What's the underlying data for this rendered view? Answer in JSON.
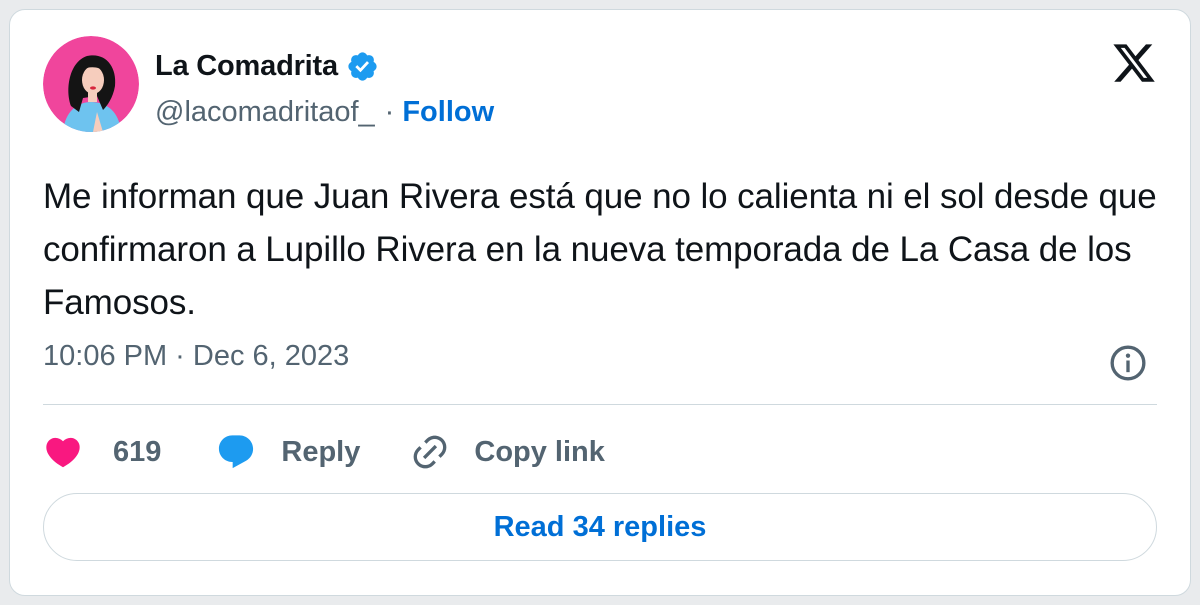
{
  "author": {
    "display_name": "La Comadrita",
    "handle": "@lacomadritaof_",
    "separator": "·",
    "follow_label": "Follow",
    "verified": true
  },
  "tweet": {
    "text": "Me informan que Juan Rivera está que no lo calienta ni el sol desde que confirmaron a Lupillo Rivera en la nueva temporada de La Casa de los Famosos.",
    "timestamp": "10:06 PM · Dec 6, 2023"
  },
  "actions": {
    "like_count": "619",
    "reply_label": "Reply",
    "copy_link_label": "Copy link"
  },
  "read_replies_label": "Read 34 replies",
  "icons": {
    "platform": "x-logo-icon",
    "verified": "verified-badge-icon",
    "info": "info-icon",
    "like": "heart-icon",
    "reply": "speech-bubble-icon",
    "copy_link": "link-icon"
  },
  "colors": {
    "accent": "#006fd6",
    "verified": "#1d9bf0",
    "like": "#f91880",
    "text": "#0f1419",
    "secondary": "#536471",
    "border": "#cfd9de",
    "avatar_bg": "#f0459c"
  }
}
